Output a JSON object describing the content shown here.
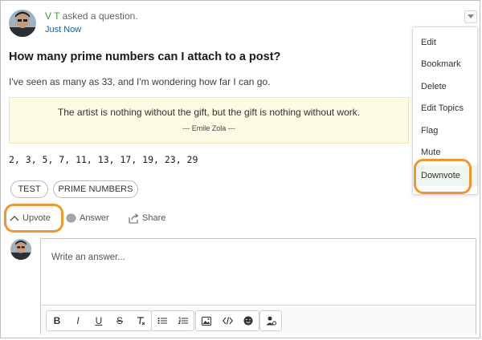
{
  "post": {
    "author_name": "V T",
    "action_text": "asked a question.",
    "timestamp": "Just Now",
    "title": "How many prime numbers can I attach to a post?",
    "body": "I've seen as many as 33, and I'm wondering how far I can go.",
    "quote": {
      "text": "The artist is nothing without the gift, but the gift is nothing without work.",
      "attribution": "--- Emile Zola ---"
    },
    "numbers": "2, 3, 5, 7, 11, 13, 17, 19, 23, 29",
    "tags": [
      "TEST",
      "PRIME NUMBERS"
    ]
  },
  "actions": {
    "upvote": "Upvote",
    "answer": "Answer",
    "share": "Share"
  },
  "menu": {
    "items": [
      "Edit",
      "Bookmark",
      "Delete",
      "Edit Topics",
      "Flag",
      "Mute",
      "Downvote"
    ],
    "highlighted": "Downvote"
  },
  "answer_editor": {
    "placeholder": "Write an answer...",
    "toolbar_icons": [
      "bold-icon",
      "italic-icon",
      "underline-icon",
      "strikethrough-icon",
      "clear-format-icon",
      "bullet-list-icon",
      "numbered-list-icon",
      "image-icon",
      "code-icon",
      "emoji-icon",
      "mention-icon"
    ]
  },
  "colors": {
    "highlight_ring": "#f0962e",
    "quote_background": "#fdfbe3",
    "author_green": "#3c9a3c",
    "time_blue": "#1a5e9a"
  }
}
